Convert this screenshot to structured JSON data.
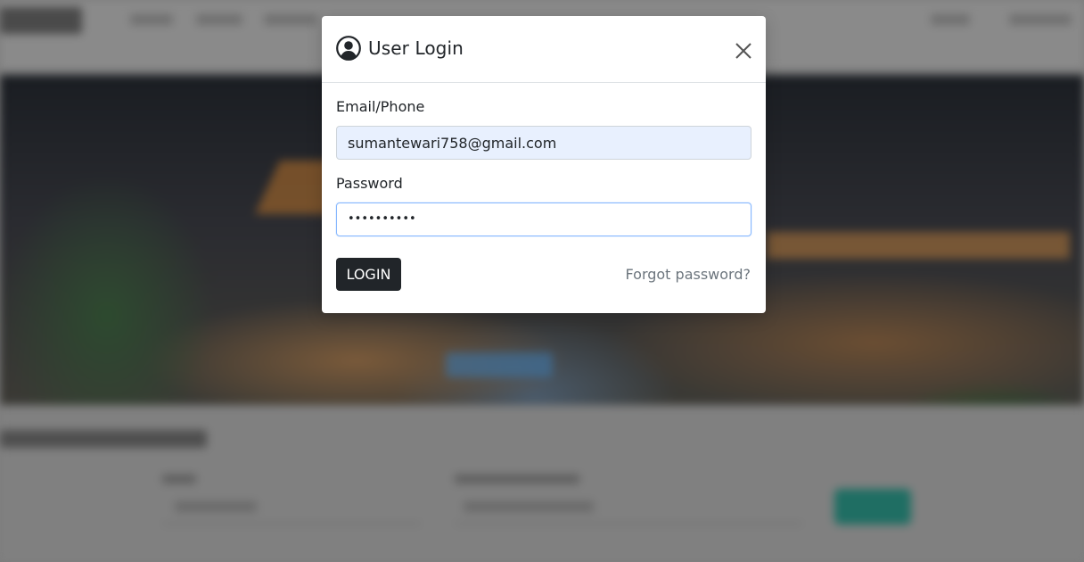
{
  "modal": {
    "title": "User Login",
    "icon": "user-circle-icon",
    "close_icon": "close-icon"
  },
  "form": {
    "email_label": "Email/Phone",
    "email_value": "sumantewari758@gmail.com",
    "password_label": "Password",
    "password_masked": "••••••••••",
    "login_label": "LOGIN",
    "forgot_label": "Forgot password?"
  },
  "colors": {
    "login_button": "#212529",
    "email_autofill_bg": "#e8f0fe",
    "password_focus_border": "#86b7fe",
    "link_gray": "#6c757d",
    "background_cta": "#1f6e63"
  }
}
